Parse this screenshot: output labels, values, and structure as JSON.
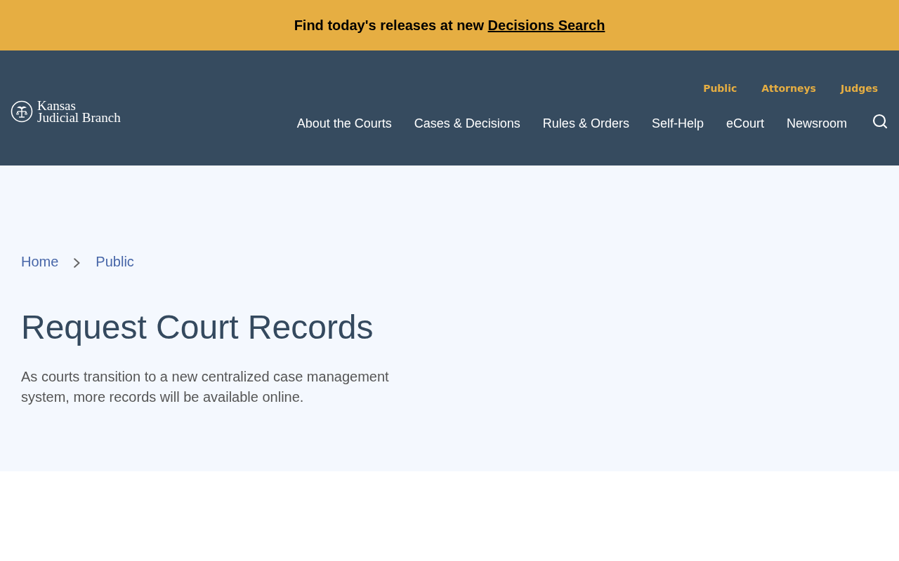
{
  "banner": {
    "text": "Find today's releases at new",
    "link": "Decisions Search"
  },
  "header": {
    "logo": {
      "lines": [
        "Kansas",
        "Judicial Branch"
      ]
    },
    "utility_links": [
      "Public",
      "Attorneys",
      "Judges"
    ],
    "nav": [
      "About the Courts",
      "Cases & Decisions",
      "Rules & Orders",
      "Self-Help",
      "eCourt",
      "Newsroom"
    ]
  },
  "hero": {
    "breadcrumb": [
      "Home",
      "Public"
    ],
    "title": "Request Court Records",
    "description": "As courts transition to a new centralized case management system, more records will be available online."
  }
}
